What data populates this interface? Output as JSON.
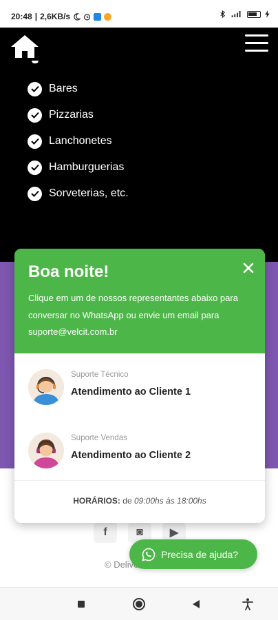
{
  "status_bar": {
    "time": "20:48",
    "network_speed": "2,6KB/s",
    "icons": [
      "moon-icon",
      "alarm-icon",
      "app-notification-icon",
      "emoji-notification-icon",
      "bluetooth-icon",
      "signal-icon",
      "battery-icon",
      "charging-icon"
    ]
  },
  "header": {
    "home_icon": "home-icon",
    "menu_icon": "hamburger-menu-icon"
  },
  "checklist": {
    "items": [
      "Bares",
      "Pizzarias",
      "Lanchonetes",
      "Hamburguerias",
      "Sorveterias, etc."
    ]
  },
  "popup": {
    "title": "Boa noite!",
    "description": "Clique em um de nossos representantes abaixo para conversar no WhatsApp ou envie um email para suporte@velcit.com.br",
    "agents": [
      {
        "role": "Suporte Técnico",
        "name": "Atendimento ao Cliente 1"
      },
      {
        "role": "Suporte Vendas",
        "name": "Atendimento ao Cliente 2"
      }
    ],
    "hours_label": "HORÁRIOS:",
    "hours_prefix": "de",
    "hours_value": "09:00hs às 18:00hs"
  },
  "footer": {
    "social": [
      "f",
      "◙",
      "▶"
    ],
    "copyright": "© Delive"
  },
  "whatsapp_button": {
    "label": "Precisa de ajuda?"
  },
  "colors": {
    "green": "#4cb748",
    "purple": "#7e57b0",
    "black": "#000000"
  }
}
